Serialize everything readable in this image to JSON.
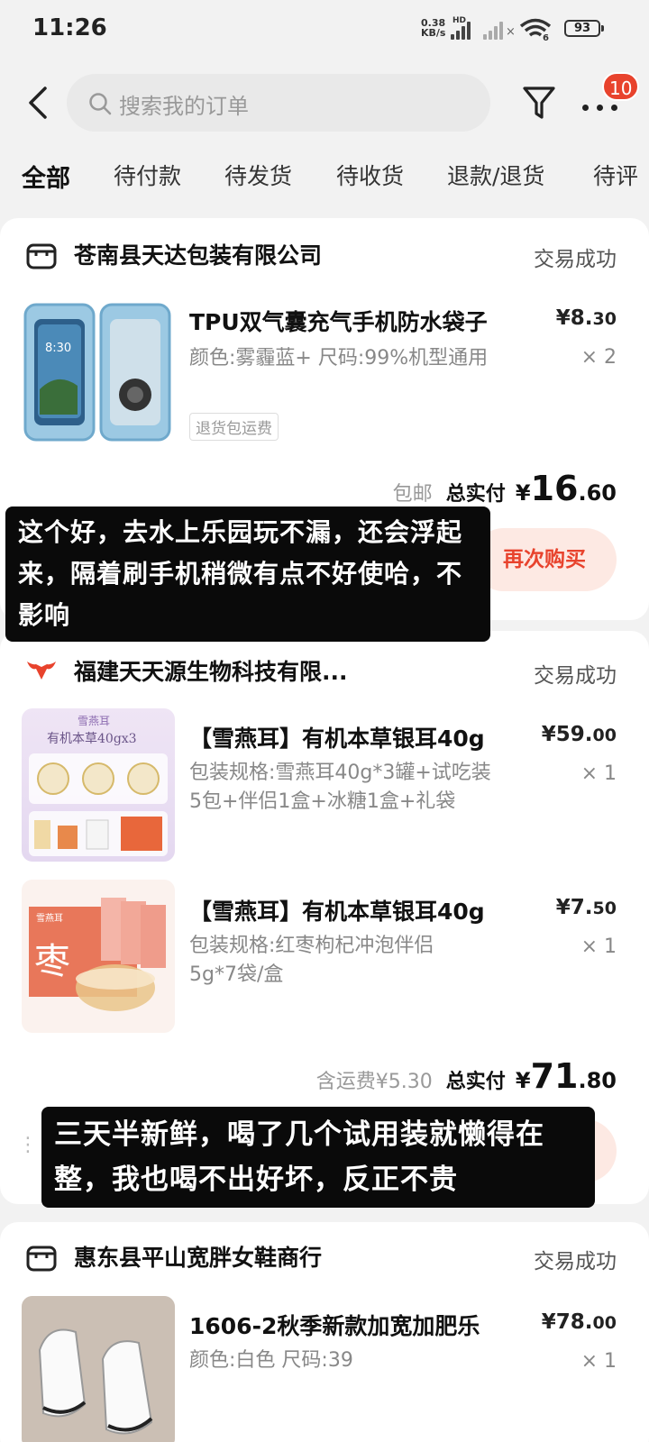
{
  "status_bar": {
    "time": "11:26",
    "net_speed_value": "0.38",
    "net_speed_unit": "KB/s",
    "hd": "HD",
    "battery": "93"
  },
  "search": {
    "placeholder": "搜索我的订单"
  },
  "badge_count": "10",
  "tabs": [
    "全部",
    "待付款",
    "待发货",
    "待收货",
    "退款/退货",
    "待评"
  ],
  "orders": [
    {
      "shop": "苍南县天达包装有限公司",
      "status": "交易成功",
      "item": {
        "title": "TPU双气囊充气手机防水袋子",
        "spec": "颜色:雾霾蓝+ 尺码:99%机型通用",
        "price_int": "¥8.",
        "price_dec": "30",
        "qty": "× 2",
        "tag": "退货包运费"
      },
      "shipping": "包邮",
      "total_label": "总实付",
      "total_yen": "¥",
      "total_int": "16",
      "total_dec": ".60",
      "button": "再次购买"
    },
    {
      "shop": "福建天天源生物科技有限...",
      "status": "交易成功",
      "items": [
        {
          "title": "【雪燕耳】有机本草银耳40g",
          "spec": "包装规格:雪燕耳40g*3罐+试吃装5包+伴侣1盒+冰糖1盒+礼袋",
          "price_int": "¥59.",
          "price_dec": "00",
          "qty": "× 1",
          "image_text": "有机本草40gx3",
          "image_brand": "雪燕耳"
        },
        {
          "title": "【雪燕耳】有机本草银耳40g",
          "spec": "包装规格:红枣枸杞冲泡伴侣5g*7袋/盒",
          "price_int": "¥7.",
          "price_dec": "50",
          "qty": "× 1",
          "image_text": "枣",
          "image_brand": "雪燕耳"
        }
      ],
      "shipping": "含运费¥5.30",
      "total_label": "总实付",
      "total_yen": "¥",
      "total_int": "71",
      "total_dec": ".80"
    },
    {
      "shop": "惠东县平山宽胖女鞋商行",
      "status": "交易成功",
      "item": {
        "title": "1606-2秋季新款加宽加肥乐",
        "spec": "颜色:白色 尺码:39",
        "price_int": "¥78.",
        "price_dec": "00",
        "qty": "× 1"
      }
    }
  ],
  "captions": [
    "这个好，去水上乐园玩不漏，还会浮起来，隔着刷手机稍微有点不好使哈，不影响",
    "三天半新鲜，喝了几个试用装就懒得在整，我也喝不出好坏，反正不贵"
  ],
  "colors": {
    "accent": "#e8432d",
    "button_bg": "#fde9e3",
    "background": "#f2f2f2",
    "caption_bg": "#0a0a0a"
  }
}
